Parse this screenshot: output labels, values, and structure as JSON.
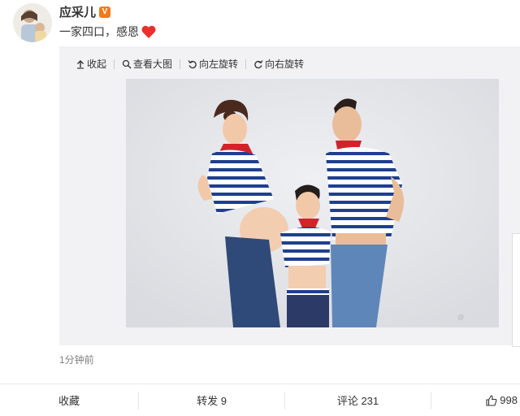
{
  "post": {
    "author": "应采儿",
    "verified_badge": "V",
    "text": "一家四口，感恩",
    "heart_icon": "heart-icon",
    "timestamp": "1分钟前"
  },
  "media_toolbar": {
    "collapse": "收起",
    "view_large": "查看大图",
    "rotate_left": "向左旋转",
    "rotate_right": "向右旋转"
  },
  "actions": {
    "favorite": "收藏",
    "repost": "转发 9",
    "comment": "评论 231",
    "like": "998"
  },
  "colors": {
    "badge": "#f27a1a",
    "heart": "#e8312f",
    "media_bg": "#f2f2f5",
    "photo_bg": "#e2e3e7",
    "shirt_blue": "#1f3f8f",
    "scarf_red": "#d2232a",
    "jeans": "#3d5a8a"
  }
}
